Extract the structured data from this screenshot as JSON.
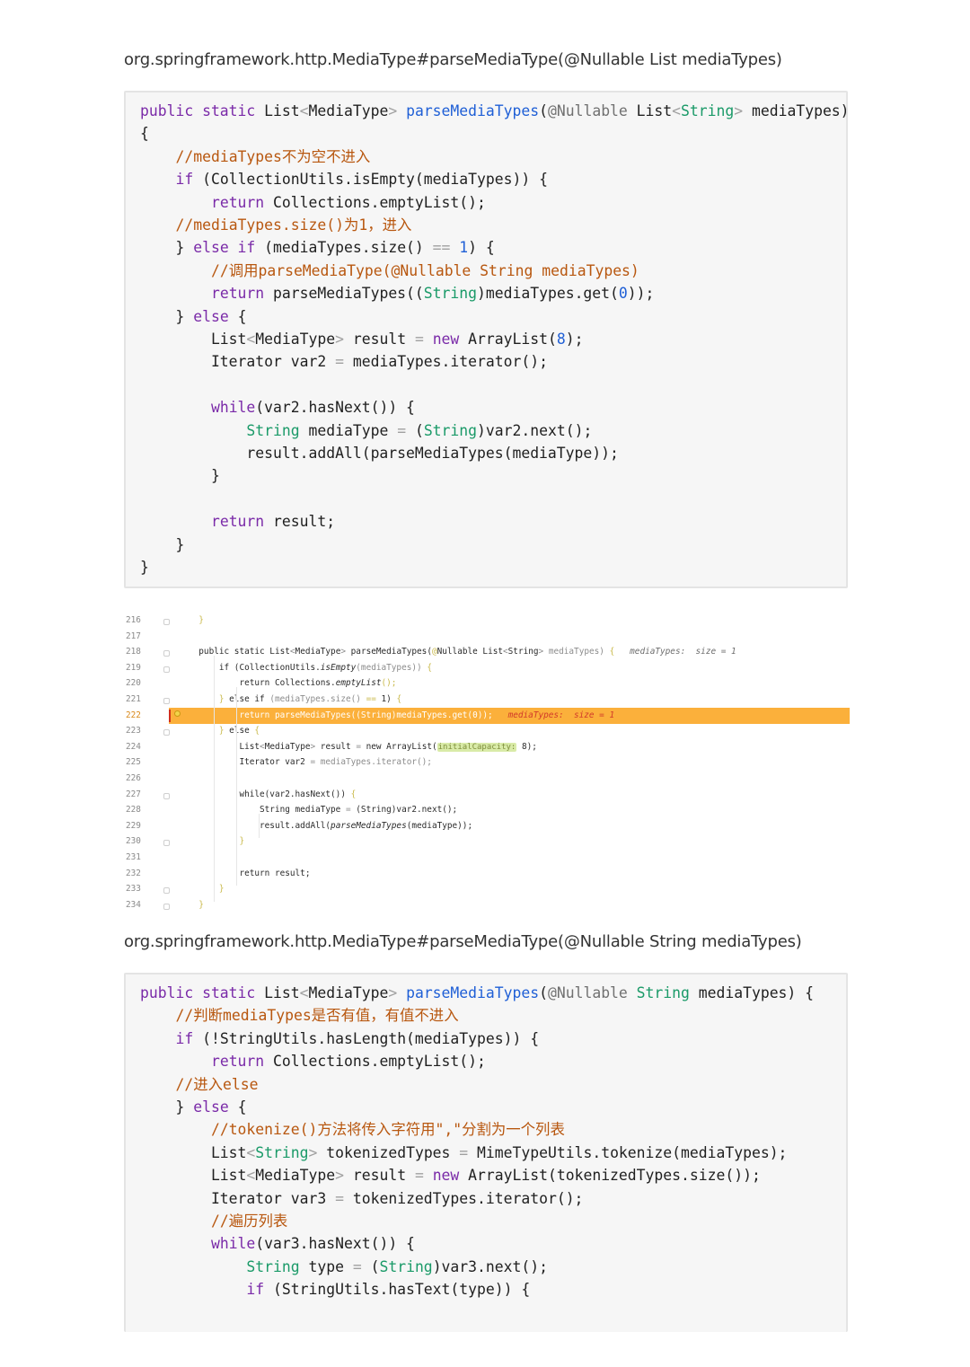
{
  "section1": {
    "heading": "org.springframework.http.MediaType#parseMediaType(@Nullable List mediaTypes)",
    "code": [
      [
        [
          "kw",
          "public static "
        ],
        [
          "",
          "List"
        ],
        [
          "op",
          "<"
        ],
        [
          "",
          "MediaType"
        ],
        [
          "op",
          "> "
        ],
        [
          "fn",
          "parseMediaTypes"
        ],
        [
          "",
          "("
        ],
        [
          "an",
          "@Nullable "
        ],
        [
          "",
          "List"
        ],
        [
          "op",
          "<"
        ],
        [
          "ty",
          "String"
        ],
        [
          "op",
          "> "
        ],
        [
          "",
          "mediaTypes)"
        ]
      ],
      [
        [
          "",
          "{"
        ]
      ],
      [
        [
          "",
          "    "
        ],
        [
          "cm",
          "//mediaTypes不为空不进入"
        ]
      ],
      [
        [
          "",
          "    "
        ],
        [
          "kw",
          "if "
        ],
        [
          "",
          "(CollectionUtils.isEmpty(mediaTypes)) {"
        ]
      ],
      [
        [
          "",
          "        "
        ],
        [
          "kw",
          "return "
        ],
        [
          "",
          "Collections.emptyList();"
        ]
      ],
      [
        [
          "",
          "    "
        ],
        [
          "cm",
          "//mediaTypes.size()为1，进入"
        ]
      ],
      [
        [
          "",
          "    } "
        ],
        [
          "kw",
          "else if "
        ],
        [
          "",
          "(mediaTypes.size() "
        ],
        [
          "op",
          "=="
        ],
        [
          "nm",
          " 1"
        ],
        [
          "",
          ") {"
        ]
      ],
      [
        [
          "",
          "        "
        ],
        [
          "cm",
          "//调用parseMediaType(@Nullable String mediaTypes)"
        ]
      ],
      [
        [
          "",
          "        "
        ],
        [
          "kw",
          "return "
        ],
        [
          "",
          "parseMediaTypes(("
        ],
        [
          "ty",
          "String"
        ],
        [
          "",
          ")mediaTypes.get("
        ],
        [
          "nm",
          "0"
        ],
        [
          "",
          "));"
        ]
      ],
      [
        [
          "",
          "    } "
        ],
        [
          "kw",
          "else "
        ],
        [
          "",
          "{"
        ]
      ],
      [
        [
          "",
          "        List"
        ],
        [
          "op",
          "<"
        ],
        [
          "",
          "MediaType"
        ],
        [
          "op",
          "> "
        ],
        [
          "",
          "result "
        ],
        [
          "op",
          "= "
        ],
        [
          "kw",
          "new "
        ],
        [
          "",
          "ArrayList("
        ],
        [
          "nm",
          "8"
        ],
        [
          "",
          ");"
        ]
      ],
      [
        [
          "",
          "        Iterator var2 "
        ],
        [
          "op",
          "= "
        ],
        [
          "",
          "mediaTypes.iterator();"
        ]
      ],
      [
        [
          "",
          ""
        ]
      ],
      [
        [
          "",
          "        "
        ],
        [
          "kw",
          "while"
        ],
        [
          "",
          "(var2.hasNext()) {"
        ]
      ],
      [
        [
          "",
          "            "
        ],
        [
          "ty",
          "String "
        ],
        [
          "",
          "mediaType "
        ],
        [
          "op",
          "= "
        ],
        [
          "",
          "("
        ],
        [
          "ty",
          "String"
        ],
        [
          "",
          ")var2.next();"
        ]
      ],
      [
        [
          "",
          "            result.addAll(parseMediaTypes(mediaType));"
        ]
      ],
      [
        [
          "",
          "        }"
        ]
      ],
      [
        [
          "",
          ""
        ]
      ],
      [
        [
          "",
          "        "
        ],
        [
          "kw",
          "return "
        ],
        [
          "",
          "result;"
        ]
      ],
      [
        [
          "",
          "    }"
        ]
      ],
      [
        [
          "",
          "}"
        ]
      ]
    ]
  },
  "ide": {
    "rows": [
      {
        "n": "216",
        "t": [
          [
            "ig",
            "  }"
          ]
        ]
      },
      {
        "n": "217",
        "t": [
          [
            "",
            ""
          ]
        ]
      },
      {
        "n": "218",
        "t": [
          [
            "ik",
            "  public static List"
          ],
          [
            "dim",
            "<"
          ],
          [
            "ik",
            "MediaType"
          ],
          [
            "dim",
            "> "
          ],
          [
            "ik",
            "parseMediaTypes("
          ],
          [
            "ig",
            "@"
          ],
          [
            "ik",
            "Nullable List"
          ],
          [
            "dim",
            "<"
          ],
          [
            "ik",
            "String"
          ],
          [
            "dim",
            "> "
          ],
          [
            "dim",
            "mediaTypes) "
          ],
          [
            "ig",
            "{"
          ],
          [
            "hint",
            "   mediaTypes:  size = 1"
          ]
        ]
      },
      {
        "n": "219",
        "t": [
          [
            "ik",
            "      if ("
          ],
          [
            "ik",
            "CollectionUtils."
          ],
          [
            "ii",
            "isEmpty"
          ],
          [
            "dim",
            "(mediaTypes)) "
          ],
          [
            "ig",
            "{"
          ]
        ]
      },
      {
        "n": "220",
        "t": [
          [
            "ik",
            "          return Collections."
          ],
          [
            "ii",
            "emptyList"
          ],
          [
            "ig",
            "();"
          ]
        ]
      },
      {
        "n": "221",
        "t": [
          [
            "ig",
            "      } "
          ],
          [
            "ik",
            "else if "
          ],
          [
            "dim",
            "(mediaTypes.size() "
          ],
          [
            "ig",
            "== "
          ],
          [
            "ik",
            "1) "
          ],
          [
            "ig",
            "{"
          ]
        ]
      },
      {
        "n": "222",
        "t": [
          [
            "",
            "          return parseMediaTypes((String)mediaTypes.get(0));"
          ],
          [
            "err",
            "   mediaTypes:  size = 1"
          ]
        ]
      },
      {
        "n": "223",
        "t": [
          [
            "ig",
            "      } "
          ],
          [
            "ik",
            "else "
          ],
          [
            "ig",
            "{"
          ]
        ]
      },
      {
        "n": "224",
        "t": [
          [
            "ik",
            "          List"
          ],
          [
            "dim",
            "<"
          ],
          [
            "ik",
            "MediaType"
          ],
          [
            "dim",
            "> "
          ],
          [
            "ik",
            "result "
          ],
          [
            "dim",
            "= "
          ],
          [
            "ik",
            "new ArrayList("
          ],
          [
            "badge",
            "initialCapacity:"
          ],
          [
            "ik",
            " 8);"
          ]
        ]
      },
      {
        "n": "225",
        "t": [
          [
            "ik",
            "          Iterator var2 "
          ],
          [
            "dim",
            "= mediaTypes.iterator();"
          ]
        ]
      },
      {
        "n": "226",
        "t": [
          [
            "",
            ""
          ]
        ]
      },
      {
        "n": "227",
        "t": [
          [
            "ik",
            "          while(var2.hasNext()) "
          ],
          [
            "ig",
            "{"
          ]
        ]
      },
      {
        "n": "228",
        "t": [
          [
            "ik",
            "              String mediaType "
          ],
          [
            "dim",
            "= "
          ],
          [
            "ik",
            "(String)var2.next();"
          ]
        ]
      },
      {
        "n": "229",
        "t": [
          [
            "ik",
            "              result.addAll("
          ],
          [
            "ii",
            "parseMediaTypes"
          ],
          [
            "ik",
            "(mediaType));"
          ]
        ]
      },
      {
        "n": "230",
        "t": [
          [
            "ig",
            "          }"
          ]
        ]
      },
      {
        "n": "231",
        "t": [
          [
            "",
            ""
          ]
        ]
      },
      {
        "n": "232",
        "t": [
          [
            "ik",
            "          return result;"
          ]
        ]
      },
      {
        "n": "233",
        "t": [
          [
            "ig",
            "      }"
          ]
        ]
      },
      {
        "n": "234",
        "t": [
          [
            "ig",
            "  }"
          ]
        ]
      }
    ]
  },
  "section2": {
    "heading": "org.springframework.http.MediaType#parseMediaType(@Nullable String mediaTypes)",
    "code": [
      [
        [
          "kw",
          "public static "
        ],
        [
          "",
          "List"
        ],
        [
          "op",
          "<"
        ],
        [
          "",
          "MediaType"
        ],
        [
          "op",
          "> "
        ],
        [
          "fn",
          "parseMediaTypes"
        ],
        [
          "",
          "("
        ],
        [
          "an",
          "@Nullable "
        ],
        [
          "ty",
          "String "
        ],
        [
          "",
          "mediaTypes) {"
        ]
      ],
      [
        [
          "",
          "    "
        ],
        [
          "cm",
          "//判断mediaTypes是否有值，有值不进入"
        ]
      ],
      [
        [
          "",
          "    "
        ],
        [
          "kw",
          "if "
        ],
        [
          "",
          "(!StringUtils.hasLength(mediaTypes)) {"
        ]
      ],
      [
        [
          "",
          "        "
        ],
        [
          "kw",
          "return "
        ],
        [
          "",
          "Collections.emptyList();"
        ]
      ],
      [
        [
          "",
          "    "
        ],
        [
          "cm",
          "//进入else"
        ]
      ],
      [
        [
          "",
          "    } "
        ],
        [
          "kw",
          "else "
        ],
        [
          "",
          "{"
        ]
      ],
      [
        [
          "",
          "        "
        ],
        [
          "cm",
          "//tokenize()方法将传入字符用\",\"分割为一个列表"
        ]
      ],
      [
        [
          "",
          "        List"
        ],
        [
          "op",
          "<"
        ],
        [
          "ty",
          "String"
        ],
        [
          "op",
          "> "
        ],
        [
          "",
          "tokenizedTypes "
        ],
        [
          "op",
          "= "
        ],
        [
          "",
          "MimeTypeUtils.tokenize(mediaTypes);"
        ]
      ],
      [
        [
          "",
          "        List"
        ],
        [
          "op",
          "<"
        ],
        [
          "",
          "MediaType"
        ],
        [
          "op",
          "> "
        ],
        [
          "",
          "result "
        ],
        [
          "op",
          "= "
        ],
        [
          "kw",
          "new "
        ],
        [
          "",
          "ArrayList(tokenizedTypes.size());"
        ]
      ],
      [
        [
          "",
          "        Iterator var3 "
        ],
        [
          "op",
          "= "
        ],
        [
          "",
          "tokenizedTypes.iterator();"
        ]
      ],
      [
        [
          "",
          "        "
        ],
        [
          "cm",
          "//遍历列表"
        ]
      ],
      [
        [
          "",
          "        "
        ],
        [
          "kw",
          "while"
        ],
        [
          "",
          "(var3.hasNext()) {"
        ]
      ],
      [
        [
          "",
          "            "
        ],
        [
          "ty",
          "String "
        ],
        [
          "",
          "type "
        ],
        [
          "op",
          "= "
        ],
        [
          "",
          "("
        ],
        [
          "ty",
          "String"
        ],
        [
          "",
          ")var3.next();"
        ]
      ],
      [
        [
          "",
          "            "
        ],
        [
          "kw",
          "if "
        ],
        [
          "",
          "(StringUtils.hasText(type)) {"
        ]
      ]
    ]
  }
}
